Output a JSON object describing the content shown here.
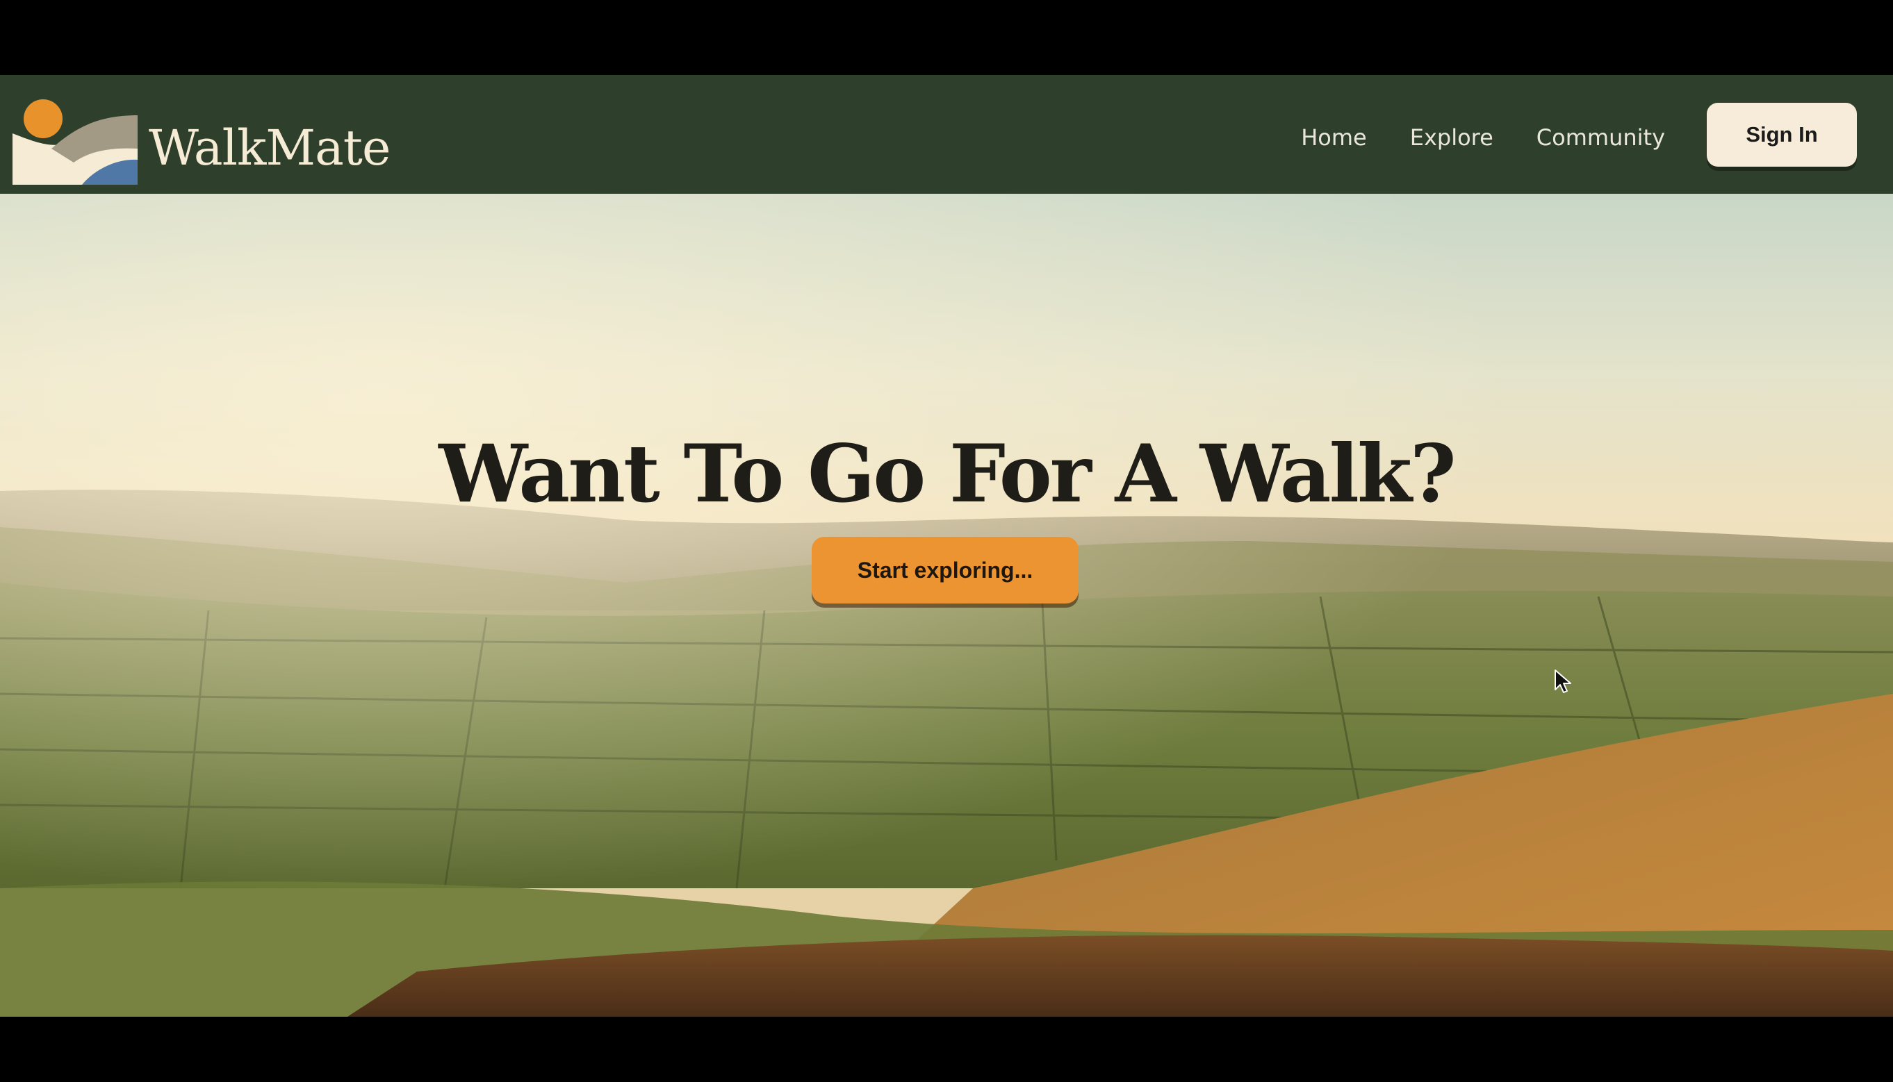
{
  "brand": {
    "name": "WalkMate",
    "logo_icon": "sun-hills-logo-icon"
  },
  "nav": {
    "links": [
      {
        "label": "Home"
      },
      {
        "label": "Explore"
      },
      {
        "label": "Community"
      }
    ],
    "signin_label": "Sign In"
  },
  "hero": {
    "title": "Want To Go For A Walk?",
    "cta_label": "Start exploring...",
    "background": "rolling-hills-landscape-photo"
  },
  "colors": {
    "nav_bg": "#2e3f2c",
    "cta": "#ec9431",
    "signin_bg": "#f7ecd9",
    "logo_sun": "#e8922c",
    "logo_blue": "#4f78a6"
  },
  "cursor": {
    "icon": "mouse-pointer-icon"
  }
}
